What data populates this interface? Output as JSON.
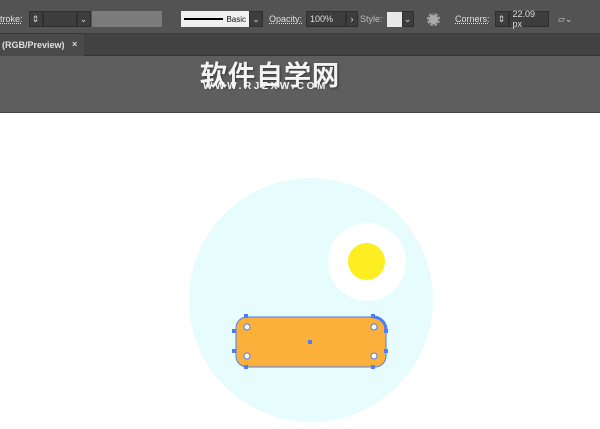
{
  "toolbar": {
    "stroke_label": "troke:",
    "stroke_style": "Basic",
    "opacity_label": "Opacity:",
    "opacity_value": "100%",
    "style_label": "Style:",
    "corners_label": "Corners:",
    "corners_value": "22.09 px"
  },
  "document_tab": {
    "title": "(RGB/Preview)",
    "close": "×"
  },
  "watermark": {
    "title": "软件自学网",
    "url": "WWW.RJZXW.COM"
  },
  "colors": {
    "bg_circle": "#e6fcfd",
    "sun_halo": "#ffffff",
    "sun": "#fcee21",
    "rect": "#fbb03b",
    "selection": "#4f7df9"
  }
}
